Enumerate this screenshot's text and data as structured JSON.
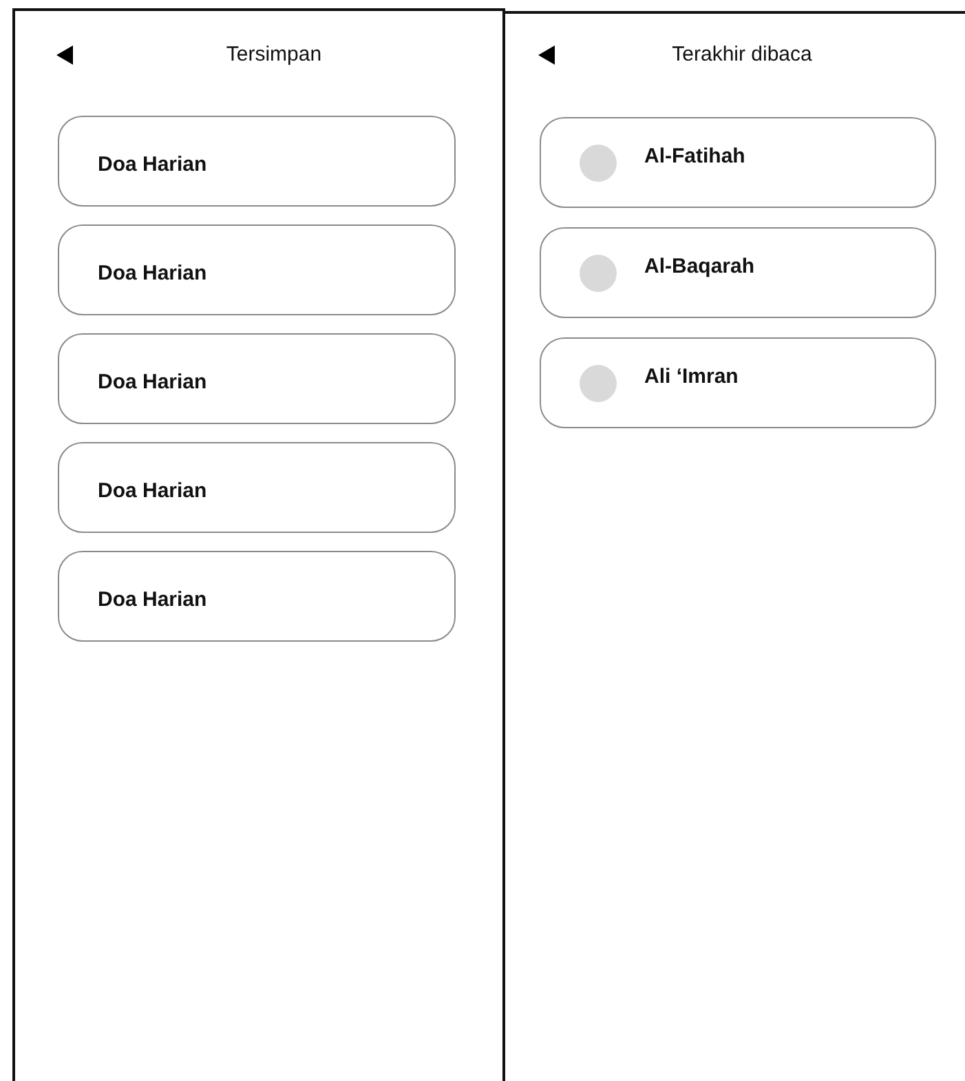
{
  "panels": [
    {
      "title": "Tersimpan",
      "items": [
        {
          "label": "Doa Harian",
          "kind": "plain"
        },
        {
          "label": "Doa Harian",
          "kind": "plain"
        },
        {
          "label": "Doa Harian",
          "kind": "plain"
        },
        {
          "label": "Doa Harian",
          "kind": "plain"
        },
        {
          "label": "Doa Harian",
          "kind": "plain"
        }
      ]
    },
    {
      "title": "Terakhir dibaca",
      "items": [
        {
          "label": "Al-Fatihah",
          "kind": "thumbnail"
        },
        {
          "label": "Al-Baqarah",
          "kind": "thumbnail"
        },
        {
          "label": "Ali ‘Imran",
          "kind": "thumbnail"
        }
      ]
    }
  ]
}
